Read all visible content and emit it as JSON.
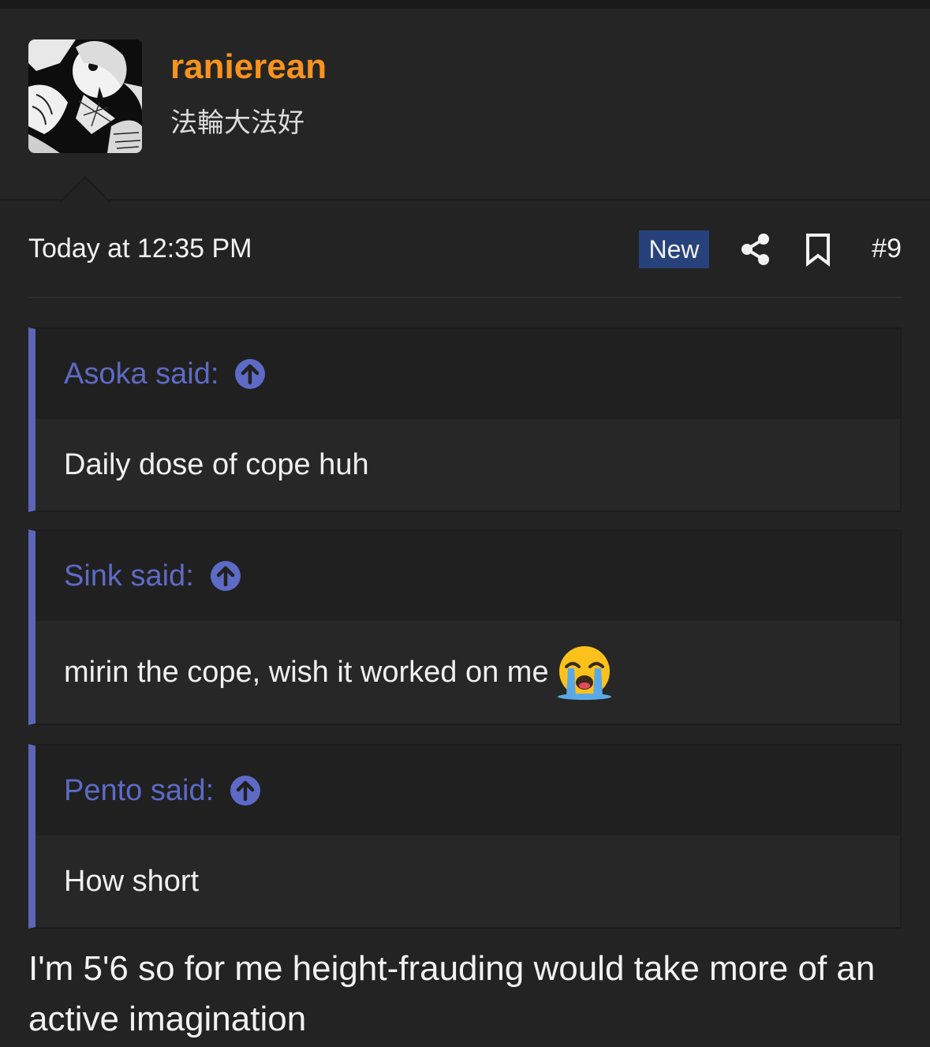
{
  "user": {
    "name": "ranierean",
    "title": "法輪大法好"
  },
  "post": {
    "timestamp": "Today at 12:35 PM",
    "badge": "New",
    "number": "#9"
  },
  "quotes": [
    {
      "attribution": "Asoka said:",
      "body": "Daily dose of cope huh"
    },
    {
      "attribution": "Sink said:",
      "body": "mirin the cope, wish it worked on me"
    },
    {
      "attribution": "Pento said:",
      "body": "How short"
    }
  ],
  "reply": "I'm 5'6 so for me height-frauding would take more of an active imagination",
  "colors": {
    "username": "#f7931e",
    "quote_accent": "#5b66b8",
    "new_badge": "#27427a",
    "background": "#232323"
  },
  "icons": [
    "share-icon",
    "bookmark-icon",
    "arrow-up-circle-icon",
    "loudly-crying-face-emoji"
  ]
}
